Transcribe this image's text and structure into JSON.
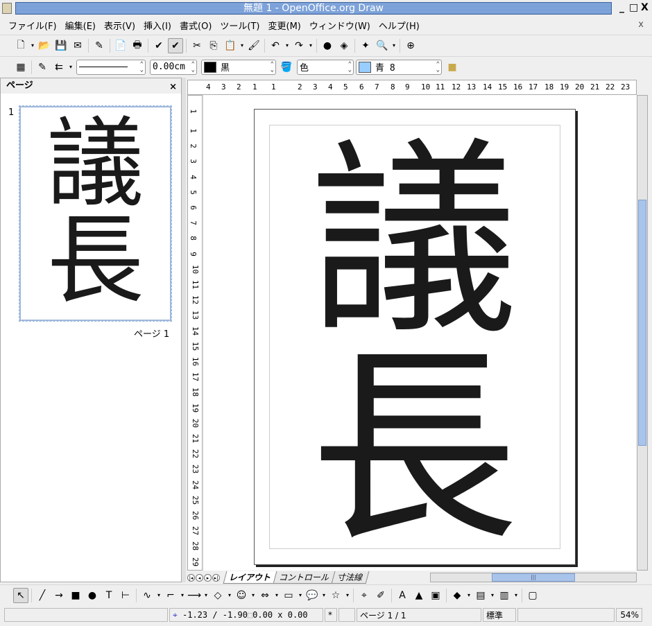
{
  "window": {
    "title": "無題 1 - OpenOffice.org Draw",
    "min": "_",
    "max": "□",
    "close": "X"
  },
  "menu": [
    "ファイル(F)",
    "編集(E)",
    "表示(V)",
    "挿入(I)",
    "書式(O)",
    "ツール(T)",
    "変更(M)",
    "ウィンドウ(W)",
    "ヘルプ(H)"
  ],
  "menu_close": "x",
  "toolbar1": [
    {
      "n": "new-icon",
      "g": "🗋",
      "dd": true
    },
    {
      "n": "open-icon",
      "g": "📂"
    },
    {
      "n": "save-icon",
      "g": "💾"
    },
    {
      "n": "email-icon",
      "g": "✉"
    },
    {
      "sep": true
    },
    {
      "n": "edit-file-icon",
      "g": "✎"
    },
    {
      "sep": true
    },
    {
      "n": "export-pdf-icon",
      "g": "📄"
    },
    {
      "n": "print-icon",
      "g": "🖶"
    },
    {
      "sep": true
    },
    {
      "n": "spellcheck-icon",
      "g": "✔"
    },
    {
      "n": "autospellcheck-icon",
      "g": "✔",
      "on": true
    },
    {
      "sep": true
    },
    {
      "n": "cut-icon",
      "g": "✂"
    },
    {
      "n": "copy-icon",
      "g": "⎘"
    },
    {
      "n": "paste-icon",
      "g": "📋",
      "dd": true
    },
    {
      "n": "format-paintbrush-icon",
      "g": "🖌"
    },
    {
      "sep": true
    },
    {
      "n": "undo-icon",
      "g": "↶",
      "dd": true
    },
    {
      "n": "redo-icon",
      "g": "↷",
      "dd": true
    },
    {
      "sep": true
    },
    {
      "n": "chart-icon",
      "g": "●"
    },
    {
      "n": "navigator-icon",
      "g": "◈"
    },
    {
      "sep": true
    },
    {
      "n": "gallery-icon",
      "g": "✦"
    },
    {
      "n": "zoom-icon",
      "g": "🔍",
      "dd": true
    },
    {
      "sep": true
    },
    {
      "n": "help-icon",
      "g": "⊕"
    }
  ],
  "toolbar2": {
    "line_width": "0.00cm",
    "line_color": "黒",
    "line_color_hex": "#000000",
    "area_style": "色",
    "area_color": "青 8",
    "area_color_hex": "#99ccff"
  },
  "pages_panel": {
    "title": "ページ",
    "close": "×",
    "page_number": "1",
    "page_label": "ページ 1"
  },
  "document": {
    "chars": [
      "議",
      "長"
    ]
  },
  "ruler_h": [
    "4",
    "3",
    "2",
    "1",
    "1",
    "2",
    "3",
    "4",
    "5",
    "6",
    "7",
    "8",
    "9",
    "10",
    "11",
    "12",
    "13",
    "14",
    "15",
    "16",
    "17",
    "18",
    "19",
    "20",
    "21",
    "22",
    "23"
  ],
  "ruler_v": [
    "1",
    "1",
    "2",
    "3",
    "4",
    "5",
    "6",
    "7",
    "8",
    "9",
    "10",
    "11",
    "12",
    "13",
    "14",
    "15",
    "16",
    "17",
    "18",
    "19",
    "20",
    "21",
    "22",
    "23",
    "24",
    "25",
    "26",
    "27",
    "28",
    "29"
  ],
  "tabs": [
    "レイアウト",
    "コントロール",
    "寸法線"
  ],
  "drawing_toolbar": [
    {
      "n": "select-icon",
      "g": "↖",
      "on": true
    },
    {
      "sep": true
    },
    {
      "n": "line-icon",
      "g": "╱"
    },
    {
      "n": "arrow-line-icon",
      "g": "→"
    },
    {
      "n": "rectangle-icon",
      "g": "■"
    },
    {
      "n": "ellipse-icon",
      "g": "●"
    },
    {
      "n": "text-icon",
      "g": "T"
    },
    {
      "n": "vertical-text-icon",
      "g": "⊢"
    },
    {
      "sep": true
    },
    {
      "n": "curve-icon",
      "g": "∿",
      "dd": true
    },
    {
      "n": "connector-icon",
      "g": "⌐",
      "dd": true
    },
    {
      "n": "lines-arrows-icon",
      "g": "⟶",
      "dd": true
    },
    {
      "n": "basic-shapes-icon",
      "g": "◇",
      "dd": true
    },
    {
      "n": "symbol-shapes-icon",
      "g": "☺",
      "dd": true
    },
    {
      "n": "block-arrows-icon",
      "g": "⇔",
      "dd": true
    },
    {
      "n": "flowchart-icon",
      "g": "▭",
      "dd": true
    },
    {
      "n": "callouts-icon",
      "g": "💬",
      "dd": true
    },
    {
      "n": "stars-icon",
      "g": "☆",
      "dd": true
    },
    {
      "sep": true
    },
    {
      "n": "points-icon",
      "g": "⌖"
    },
    {
      "n": "glue-points-icon",
      "g": "✐"
    },
    {
      "sep": true
    },
    {
      "n": "fontwork-icon",
      "g": "A"
    },
    {
      "n": "from-file-icon",
      "g": "▲"
    },
    {
      "n": "gallery-icon",
      "g": "▣"
    },
    {
      "sep": true
    },
    {
      "n": "rotate-icon",
      "g": "◆",
      "dd": true
    },
    {
      "n": "align-icon",
      "g": "▤",
      "dd": true
    },
    {
      "n": "arrange-icon",
      "g": "▥",
      "dd": true
    },
    {
      "sep": true
    },
    {
      "n": "extrusion-icon",
      "g": "▢"
    }
  ],
  "status": {
    "position": "-1.23 / -1.90",
    "size": "0.00 x 0.00",
    "modified": "*",
    "page": "ページ 1 / 1",
    "layout": "標準",
    "zoom": "54%"
  }
}
